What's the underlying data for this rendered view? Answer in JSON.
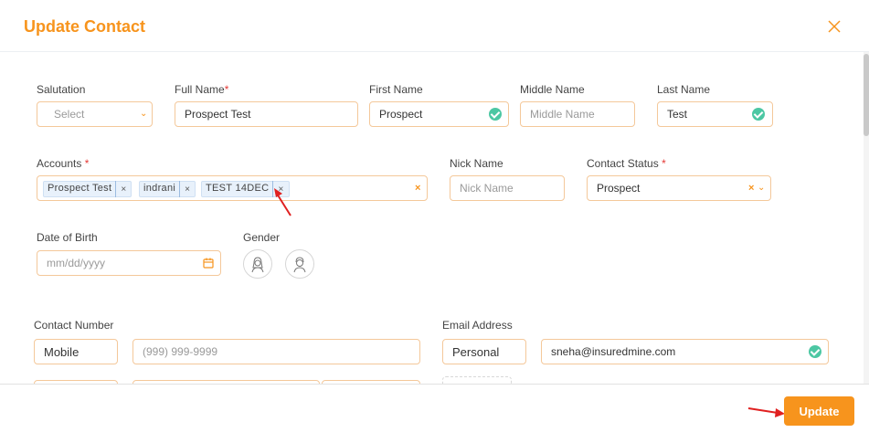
{
  "modal": {
    "title": "Update Contact",
    "accent_color": "#f7941d",
    "close_icon": "close-icon"
  },
  "form": {
    "salutation": {
      "label": "Salutation",
      "placeholder": "Select"
    },
    "full_name": {
      "label": "Full Name",
      "required_mark": "*",
      "value": "Prospect Test"
    },
    "first_name": {
      "label": "First Name",
      "value": "Prospect"
    },
    "middle_name": {
      "label": "Middle Name",
      "placeholder": "Middle Name"
    },
    "last_name": {
      "label": "Last Name",
      "value": "Test"
    },
    "accounts": {
      "label": "Accounts",
      "required_mark": "*",
      "tags": [
        "Prospect Test",
        "indrani",
        "TEST 14DEC"
      ],
      "remove_glyph": "×",
      "clear_glyph": "×"
    },
    "nick_name": {
      "label": "Nick Name",
      "placeholder": "Nick Name"
    },
    "contact_status": {
      "label": "Contact Status",
      "required_mark": "*",
      "value": "Prospect"
    },
    "date_of_birth": {
      "label": "Date of Birth",
      "placeholder": "mm/dd/yyyy"
    },
    "gender": {
      "label": "Gender",
      "options": [
        "female-avatar-icon",
        "male-avatar-icon"
      ]
    },
    "contact_number": {
      "label": "Contact Number",
      "type_value": "Mobile",
      "placeholder": "(999) 999-9999"
    },
    "email_address": {
      "label": "Email Address",
      "type_value": "Personal",
      "value": "sneha@insuredmine.com"
    }
  },
  "footer": {
    "update_label": "Update"
  },
  "annotation_color": "#e02020"
}
